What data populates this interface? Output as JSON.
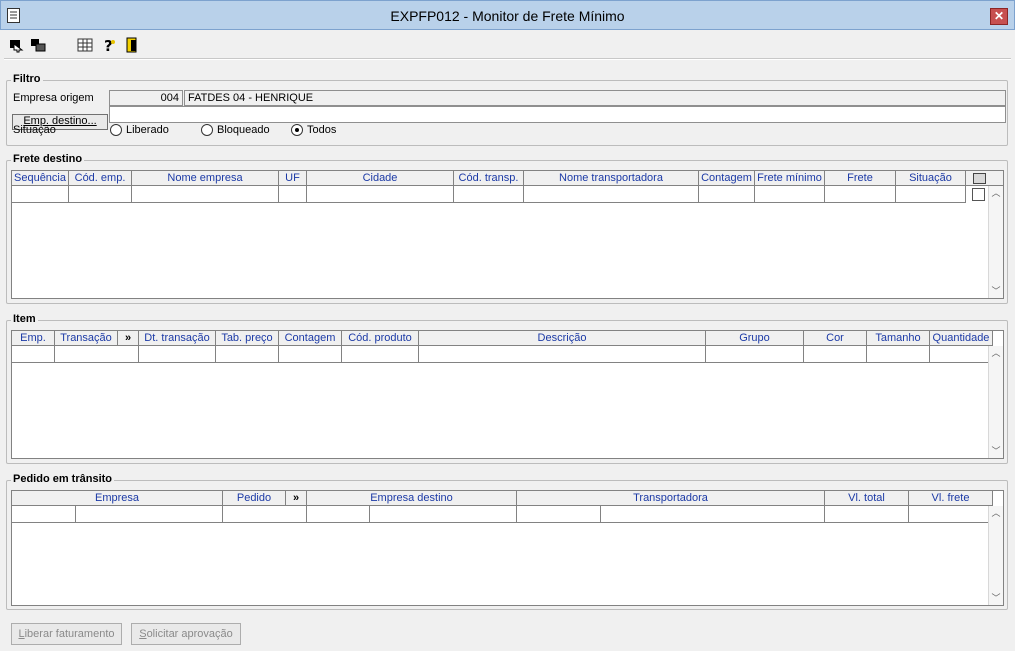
{
  "window": {
    "title": "EXPFP012 - Monitor de Frete Mínimo",
    "close_label": "✕"
  },
  "toolbar": {
    "icons": [
      "enter-arrow-icon",
      "copy-window-icon",
      "table-icon",
      "help-icon",
      "exit-door-icon"
    ]
  },
  "filtro": {
    "label": "Filtro",
    "empresa_origem_label": "Empresa origem",
    "empresa_origem_code": "004",
    "empresa_origem_name": "FATDES 04 - HENRIQUE",
    "emp_destino_button": "Emp. destino...",
    "emp_destino_value": "",
    "situacao_label": "Situação",
    "radios": [
      {
        "label": "Liberado",
        "checked": false
      },
      {
        "label": "Bloqueado",
        "checked": false
      },
      {
        "label": "Todos",
        "checked": true
      }
    ]
  },
  "frete_destino": {
    "label": "Frete destino",
    "columns": [
      "Sequência",
      "Cód. emp.",
      "Nome empresa",
      "UF",
      "Cidade",
      "Cód. transp.",
      "Nome transportadora",
      "Contagem",
      "Frete mínimo",
      "Frete",
      "Situação"
    ]
  },
  "item": {
    "label": "Item",
    "columns": [
      "Emp.",
      "Transação",
      "»",
      "Dt. transação",
      "Tab. preço",
      "Contagem",
      "Cód. produto",
      "Descrição",
      "Grupo",
      "Cor",
      "Tamanho",
      "Quantidade"
    ]
  },
  "pedido": {
    "label": "Pedido em trânsito",
    "columns": [
      "Empresa",
      "Pedido",
      "»",
      "Empresa destino",
      "Transportadora",
      "Vl. total",
      "Vl. frete"
    ]
  },
  "buttons": {
    "liberar_prefix": "L",
    "liberar_rest": "iberar faturamento",
    "solicitar_prefix": "S",
    "solicitar_rest": "olicitar aprovação"
  },
  "colors": {
    "title_bar": "#b9d1ea",
    "header_text": "#1c3aa6",
    "close_button": "#c75050"
  }
}
